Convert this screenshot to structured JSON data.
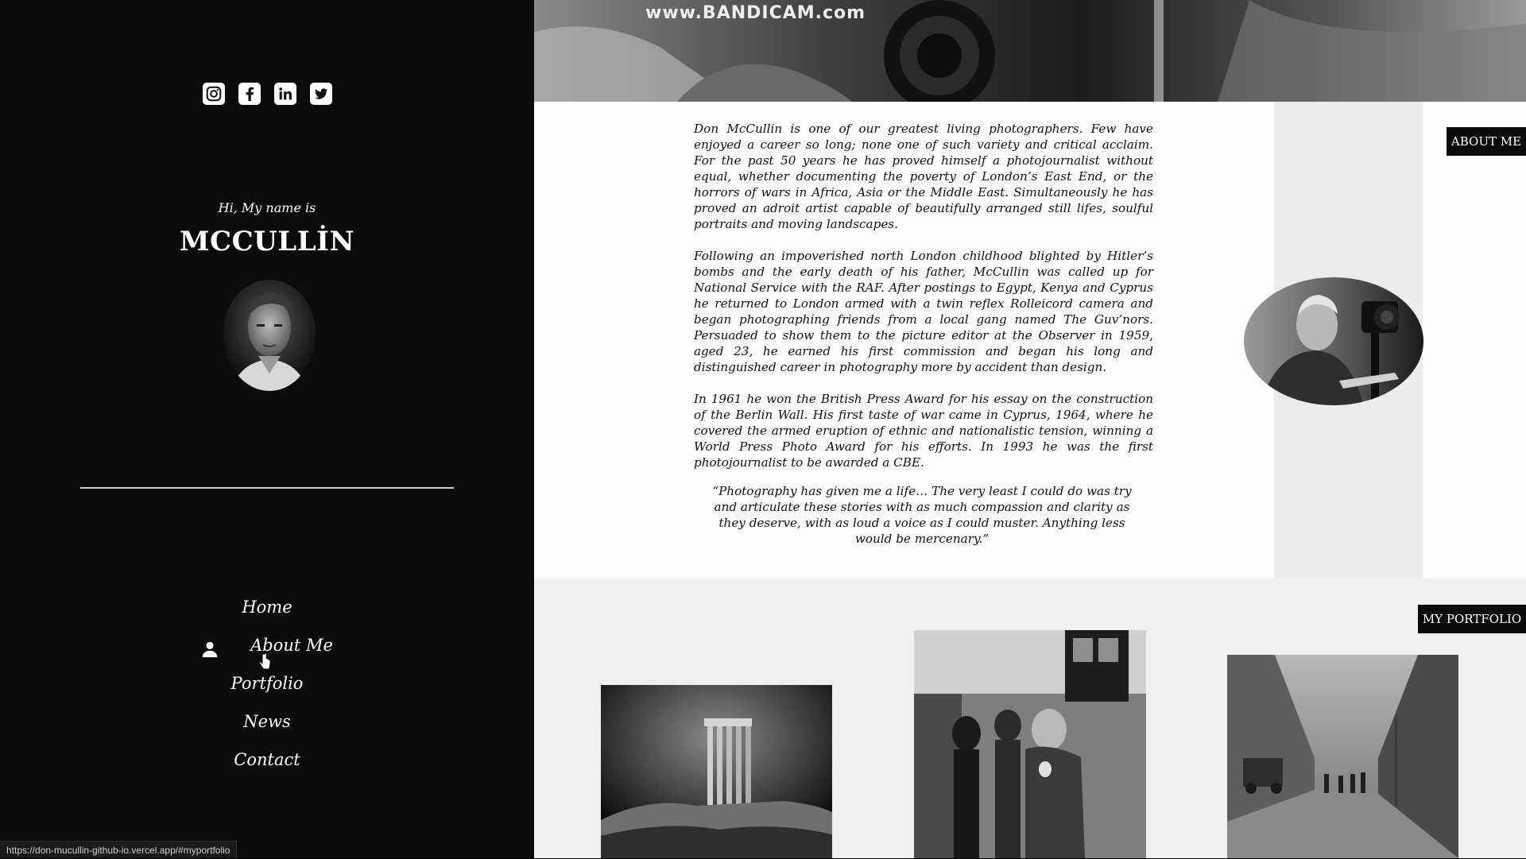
{
  "sidebar": {
    "socials": [
      {
        "icon": "instagram-icon"
      },
      {
        "icon": "facebook-icon"
      },
      {
        "icon": "linkedin-icon"
      },
      {
        "icon": "twitter-icon"
      }
    ],
    "greeting": "Hi, My name is",
    "name": "MCCULLİN",
    "nav": [
      {
        "label": "Home"
      },
      {
        "label": "About Me",
        "icon": "user-icon"
      },
      {
        "label": "Portfolio"
      },
      {
        "label": "News"
      },
      {
        "label": "Contact"
      }
    ],
    "status_url": "https://don-mucullin-github-io.vercel.app/#myportfolio"
  },
  "main": {
    "watermark": "www.BANDICAM.com",
    "about": {
      "badge": "ABOUT ME",
      "paragraphs": [
        "Don McCullin is one of our greatest living photographers. Few have enjoyed a career so long; none one of such variety and critical acclaim. For the past 50 years he has proved himself a photojournalist without equal, whether documenting the poverty of London’s East End, or the horrors of wars in Africa, Asia or the Middle East. Simultaneously he has proved an adroit artist capable of beautifully arranged still lifes, soulful portraits and moving landscapes.",
        "Following an impoverished north London childhood blighted by Hitler’s bombs and the early death of his father, McCullin was called up for National Service with the RAF. After postings to Egypt, Kenya and Cyprus he returned to London armed with a twin reflex Rolleicord camera and began photographing friends from a local gang named The Guv’nors. Persuaded to show them to the picture editor at the Observer in 1959, aged 23, he earned his first commission and began his long and distinguished career in photography more by accident than design.",
        "In 1961 he won the British Press Award for his essay on the construction of the Berlin Wall. His first taste of war came in Cyprus, 1964, where he covered the armed eruption of ethnic and nationalistic tension, winning a World Press Photo Award for his efforts. In 1993 he was the first photojournalist to be awarded a CBE."
      ],
      "quote": "“Photography has given me a life… The very least I could do was try and articulate these stories with as much compassion and clarity as they deserve, with as loud a voice as I could muster. Anything less would be mercenary.”"
    },
    "portfolio": {
      "badge": "MY PORTFOLIO"
    }
  }
}
